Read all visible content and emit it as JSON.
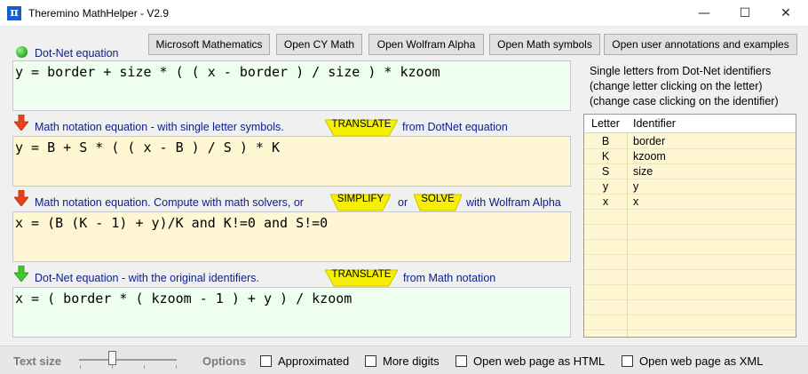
{
  "window": {
    "title": "Theremino MathHelper - V2.9",
    "app_icon": "π",
    "controls": {
      "minimize": "—",
      "maximize": "☐",
      "close": "✕"
    }
  },
  "toolbar": {
    "buttons": [
      "Microsoft Mathematics",
      "Open CY Math",
      "Open Wolfram Alpha",
      "Open Math symbols",
      "Open user annotations and examples"
    ]
  },
  "sections": {
    "dotnet": {
      "label": "Dot-Net equation",
      "status_color": "#22aa22",
      "equation": "y = border + size * ( ( x - border ) / size ) * kzoom"
    },
    "math_single": {
      "label": "Math notation equation - with single letter symbols.",
      "translate_label": "TRANSLATE",
      "after_label": "from DotNet equation",
      "equation": "y = B + S * ( ( x - B ) / S ) * K"
    },
    "math_solve": {
      "label": "Math notation equation.   Compute with math solvers,  or",
      "simplify_label": "SIMPLIFY",
      "or_label": "or",
      "solve_label": "SOLVE",
      "after_label": "with Wolfram Alpha",
      "equation": "x = (B (K - 1) + y)/K and K!=0 and S!=0"
    },
    "dotnet_original": {
      "label": "Dot-Net equation - with the original identifiers.",
      "translate_label": "TRANSLATE",
      "after_label": "from Math notation",
      "equation": "x = ( border * ( kzoom - 1 ) + y ) / kzoom"
    }
  },
  "identifiers_panel": {
    "info_lines": [
      "Single letters from Dot-Net identifiers",
      "(change letter clicking on the letter)",
      "(change case clicking on the identifier)"
    ],
    "columns": [
      "Letter",
      "Identifier"
    ],
    "rows": [
      {
        "letter": "B",
        "identifier": "border"
      },
      {
        "letter": "K",
        "identifier": "kzoom"
      },
      {
        "letter": "S",
        "identifier": "size"
      },
      {
        "letter": "y",
        "identifier": "y"
      },
      {
        "letter": "x",
        "identifier": "x"
      }
    ]
  },
  "bottom": {
    "text_size_label": "Text size",
    "options_label": "Options",
    "checkboxes": [
      {
        "label": "Approximated",
        "checked": false
      },
      {
        "label": "More digits",
        "checked": false
      },
      {
        "label": "Open web page as HTML",
        "checked": false
      },
      {
        "label": "Open web page as XML",
        "checked": false
      }
    ]
  },
  "colors": {
    "label_blue": "#0a1c8c",
    "green_box": "#efffef",
    "yellow_box": "#fff7d3",
    "pill_yellow": "#f6f000",
    "arrow_red": "#e8421a",
    "arrow_green": "#3ecb2c"
  }
}
